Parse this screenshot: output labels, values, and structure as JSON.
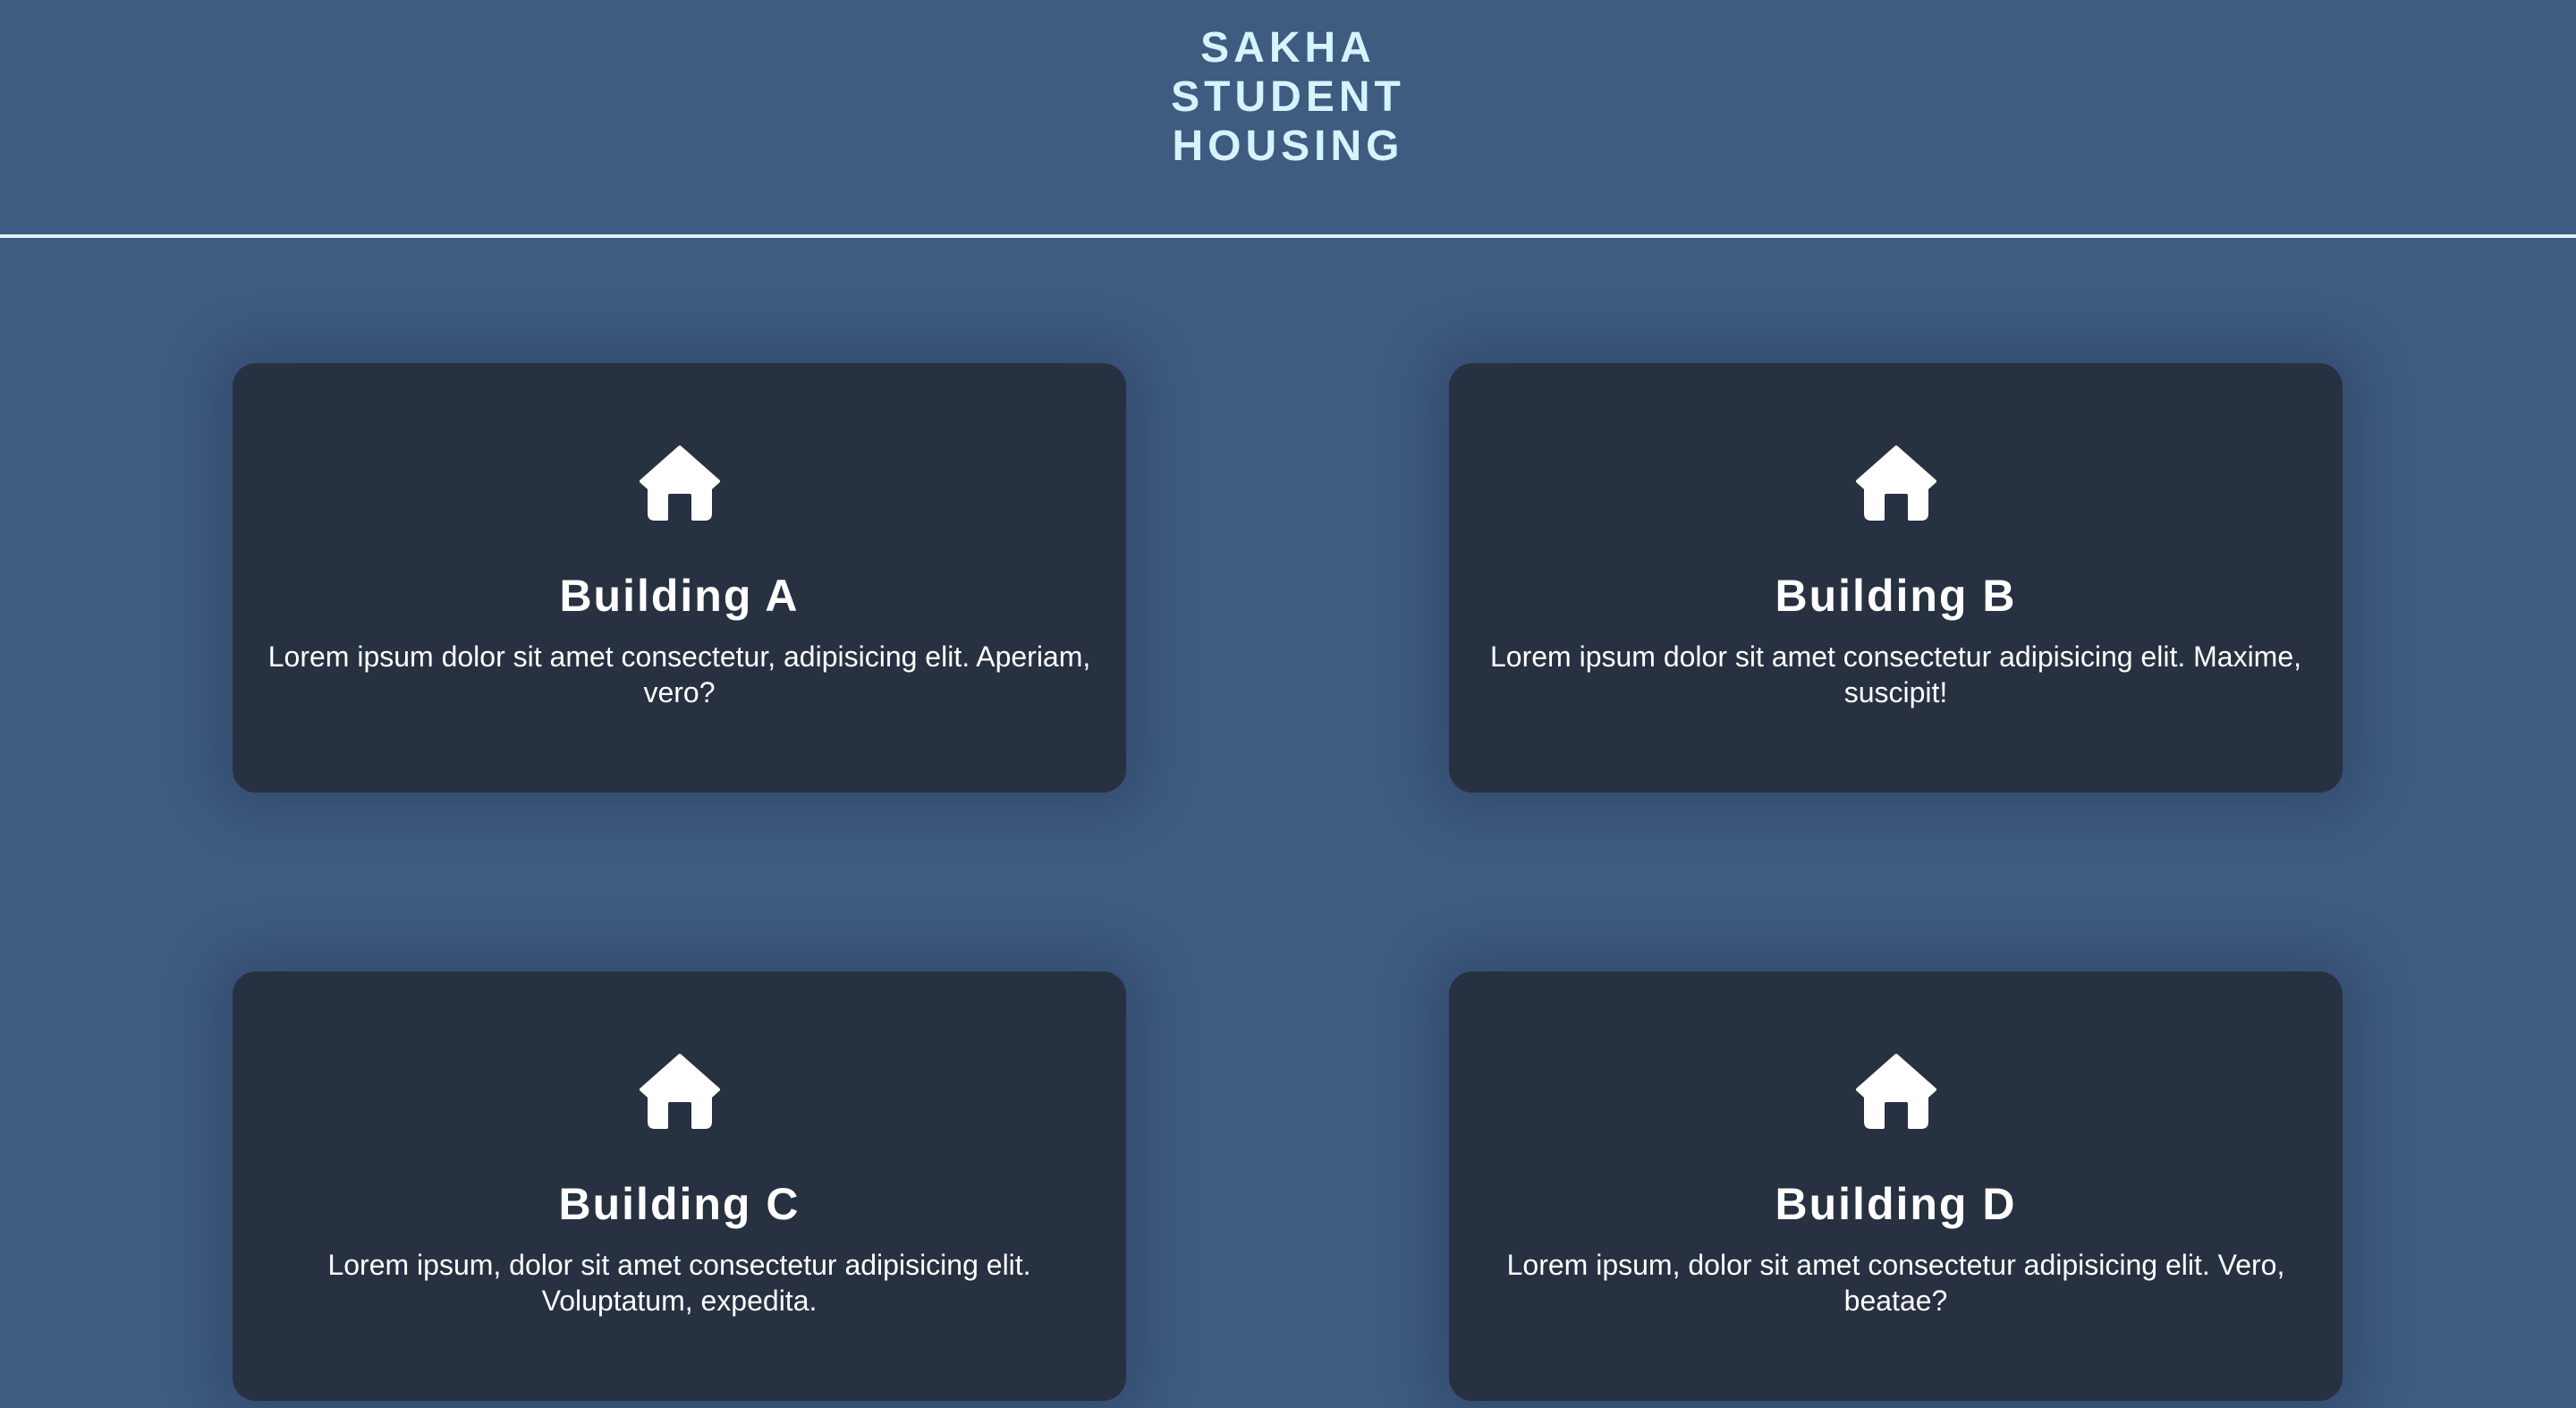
{
  "header": {
    "title_lines": [
      "SAKHA",
      "STUDENT",
      "HOUSING"
    ]
  },
  "colors": {
    "background": "#3e5b80",
    "card": "#273141",
    "title": "#d6f3ff",
    "text": "#ffffff"
  },
  "buildings": [
    {
      "icon": "house-icon",
      "title": "Building A",
      "description": "Lorem ipsum dolor sit amet consectetur, adipisicing elit. Aperiam, vero?"
    },
    {
      "icon": "house-icon",
      "title": "Building B",
      "description": "Lorem ipsum dolor sit amet consectetur adipisicing elit. Maxime, suscipit!"
    },
    {
      "icon": "house-icon",
      "title": "Building C",
      "description": "Lorem ipsum, dolor sit amet consectetur adipisicing elit. Voluptatum, expedita."
    },
    {
      "icon": "house-icon",
      "title": "Building D",
      "description": "Lorem ipsum, dolor sit amet consectetur adipisicing elit. Vero, beatae?"
    }
  ]
}
